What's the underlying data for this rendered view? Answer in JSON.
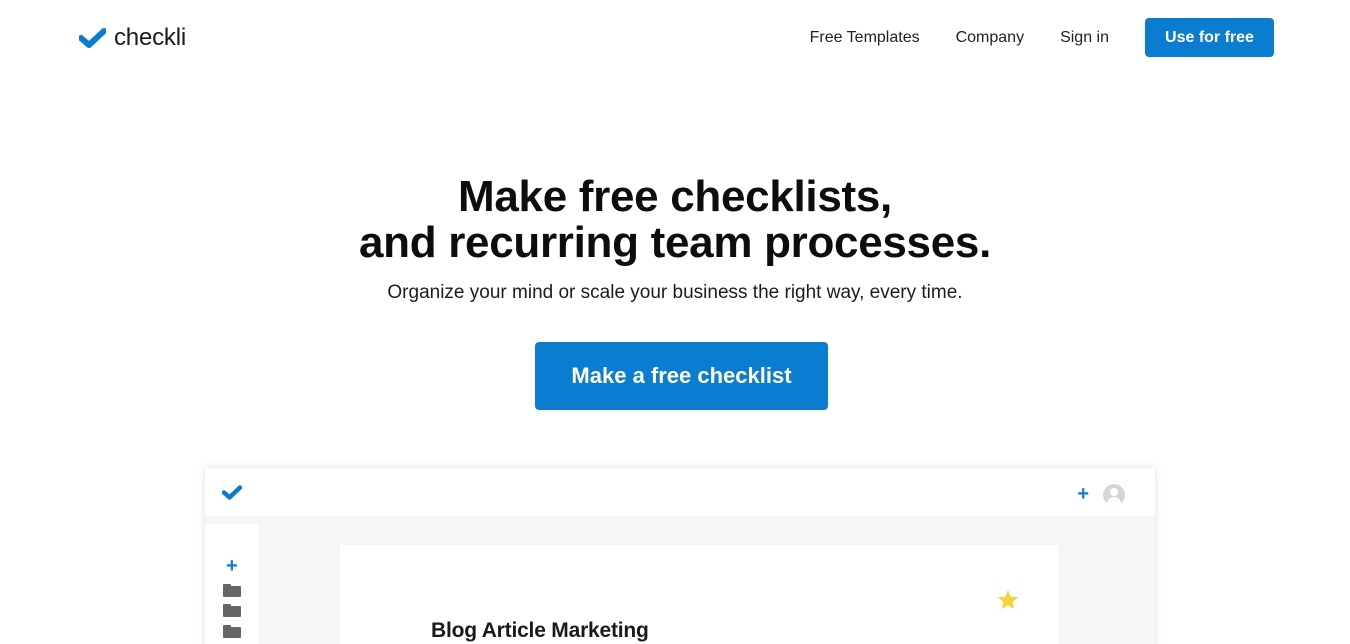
{
  "header": {
    "brand": "checkli",
    "nav": [
      "Free Templates",
      "Company",
      "Sign in"
    ],
    "cta": "Use for free",
    "accent_color": "#0b7dd1"
  },
  "hero": {
    "title_line1": "Make free checklists,",
    "title_line2": "and recurring team processes.",
    "subtitle": "Organize your mind or scale your business the right way, every time.",
    "cta": "Make a free checklist"
  },
  "preview": {
    "icons": [
      "checkmark-logo-icon",
      "plus-icon",
      "avatar-icon",
      "folder-icon",
      "star-icon"
    ],
    "card_title": "Blog Article Marketing",
    "star_color": "#f6d33a"
  }
}
